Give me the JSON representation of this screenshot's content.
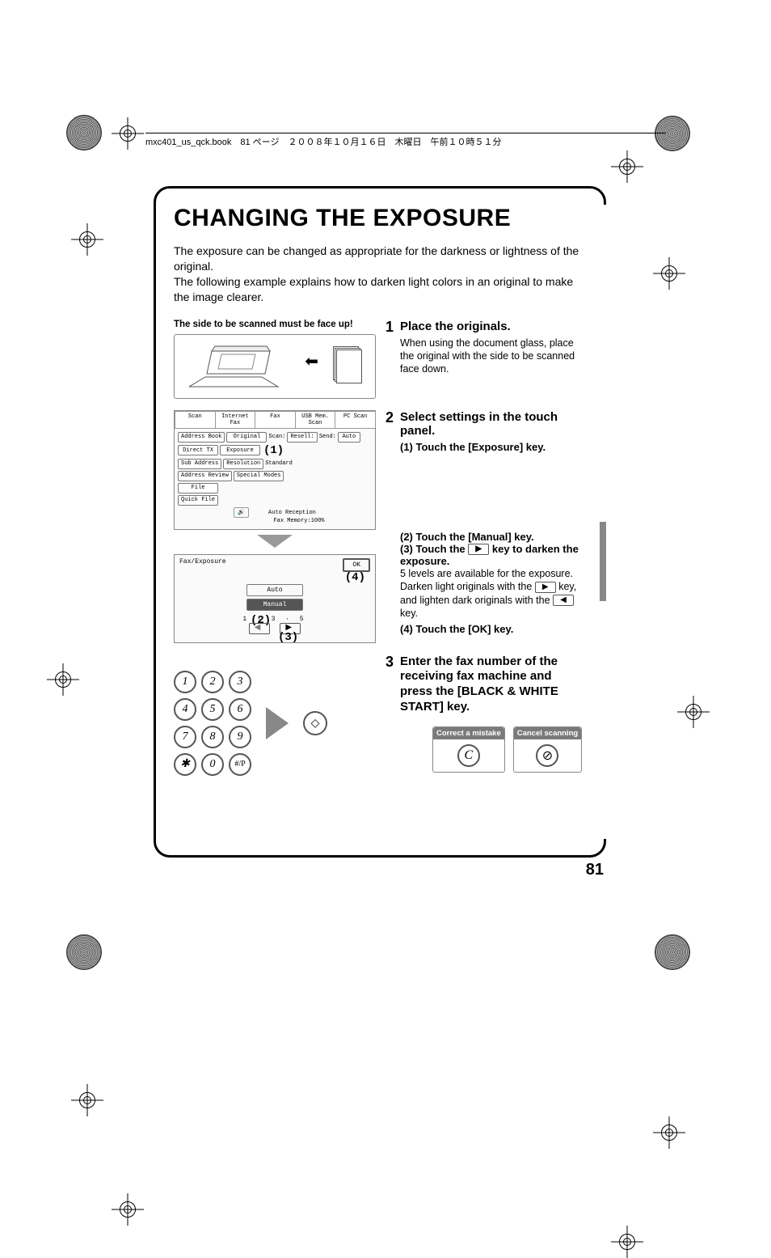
{
  "header_text": "mxc401_us_qck.book　81 ページ　２００８年１０月１６日　木曜日　午前１０時５１分",
  "title": "CHANGING THE EXPOSURE",
  "intro_1": "The exposure can be changed as appropriate for the darkness or lightness of the original.",
  "intro_2": "The following example explains how to darken light colors in an original to make the image clearer.",
  "scan_caption": "The side to be scanned must be face up!",
  "step1": {
    "num": "1",
    "title": "Place the originals.",
    "body": "When using the document glass, place the original with the side to be scanned face down."
  },
  "panel1": {
    "tabs": [
      "Scan",
      "Internet Fax",
      "Fax",
      "USB Mem. Scan",
      "PC Scan"
    ],
    "row_labels": {
      "scan": "Scan:",
      "resell": "Resell:",
      "send": "Send:",
      "auto": "Auto"
    },
    "left_keys": [
      "Address Book",
      "Direct TX",
      "Sub Address",
      "Address Review",
      "File",
      "Quick File"
    ],
    "mid_keys": [
      "Original",
      "Exposure",
      "Resolution",
      "Special Modes"
    ],
    "mid_vals": [
      "",
      "",
      "Standard",
      ""
    ],
    "footer1": "Auto Reception",
    "footer2": "Fax Memory:100%",
    "callout": "(1)"
  },
  "step2": {
    "num": "2",
    "title": "Select settings in the touch panel.",
    "sub1": "(1) Touch the [Exposure] key.",
    "sub2": "(2) Touch the [Manual] key.",
    "sub3a": "(3) Touch the ",
    "sub3b": " key to darken the exposure.",
    "note1a": "5 levels are available for the exposure. Darken light originals with the ",
    "note1b": " key, and lighten dark originals with the ",
    "note1c": " key.",
    "sub4": "(4) Touch the [OK] key."
  },
  "panel2": {
    "title": "Fax/Exposure",
    "ok": "OK",
    "auto": "Auto",
    "manual": "Manual",
    "callout_ok": "(4)",
    "callout_manual": "(2)",
    "callout_arrow": "(3)",
    "scale": "1   ·   3   ·   5"
  },
  "step3": {
    "num": "3",
    "title": "Enter the fax number of the receiving fax machine and press the [BLACK & WHITE START] key."
  },
  "keypad": [
    "1",
    "2",
    "3",
    "4",
    "5",
    "6",
    "7",
    "8",
    "9",
    "✱",
    "0",
    "#/P"
  ],
  "mini": {
    "correct": "Correct a mistake",
    "cancel": "Cancel scanning",
    "c_key": "C"
  },
  "page_number": "81"
}
